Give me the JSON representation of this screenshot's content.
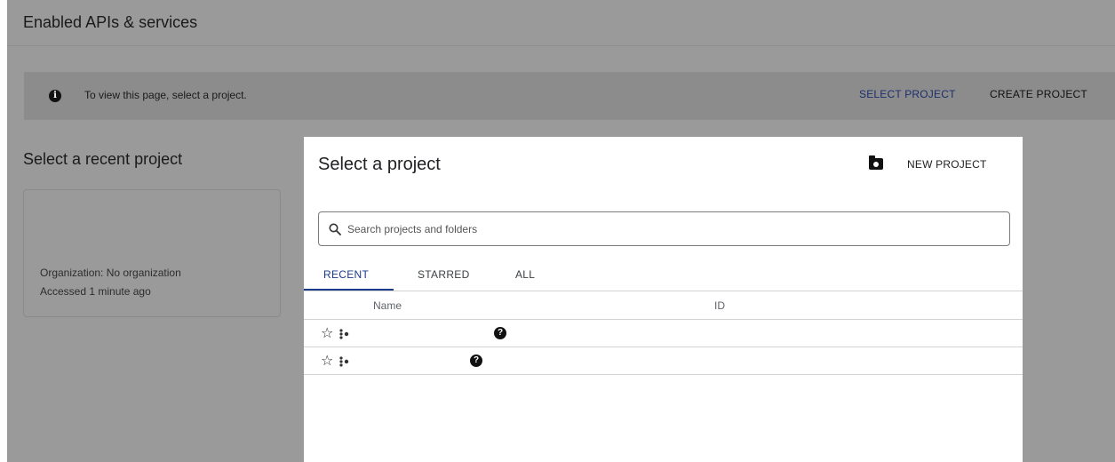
{
  "page": {
    "title": "Enabled APIs & services"
  },
  "banner": {
    "message": "To view this page, select a project.",
    "select_project_label": "SELECT PROJECT",
    "create_project_label": "CREATE PROJECT"
  },
  "recent_projects": {
    "heading": "Select a recent project",
    "cards": [
      {
        "organization": "Organization: No organization",
        "accessed": "Accessed 1 minute ago"
      }
    ]
  },
  "modal": {
    "title": "Select a project",
    "new_project_label": "NEW PROJECT",
    "search_placeholder": "Search projects and folders",
    "tabs": [
      {
        "label": "RECENT",
        "active": true
      },
      {
        "label": "STARRED",
        "active": false
      },
      {
        "label": "ALL",
        "active": false
      }
    ],
    "columns": [
      "Name",
      "ID"
    ],
    "rows": [
      {
        "starred": false,
        "name": "",
        "id": ""
      },
      {
        "starred": false,
        "name": "",
        "id": ""
      }
    ],
    "icons": {
      "star": "star-outline-icon",
      "project": "project-icon",
      "help": "help-icon"
    }
  },
  "colors": {
    "accent": "#1a3a8a",
    "backdrop": "#9a9a9a",
    "banner": "#8c8c8c"
  }
}
